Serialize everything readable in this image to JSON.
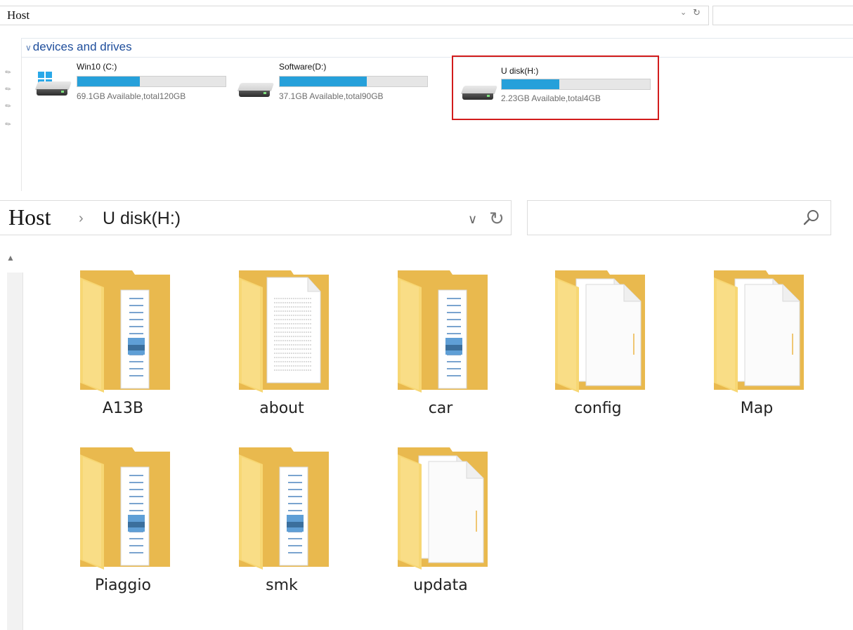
{
  "top_bar": {
    "location": "Host"
  },
  "devices_group": {
    "title": "devices and drives"
  },
  "drives": [
    {
      "name": "Win10 (C:)",
      "info": "69.1GB Available,total120GB",
      "used_fraction": 0.42,
      "icon": "windows-drive-icon",
      "selected": false
    },
    {
      "name": "Software(D:)",
      "info": "37.1GB Available,total90GB",
      "used_fraction": 0.59,
      "icon": "hard-drive-icon",
      "selected": false
    },
    {
      "name": "U disk(H:)",
      "info": "2.23GB Available,total4GB",
      "used_fraction": 0.39,
      "icon": "hard-drive-icon",
      "selected": true
    }
  ],
  "main_bar": {
    "root": "Host",
    "separator": "›",
    "location": "U disk(H:)"
  },
  "folders": [
    {
      "name": "A13B",
      "style": "document"
    },
    {
      "name": "about",
      "style": "text"
    },
    {
      "name": "car",
      "style": "document"
    },
    {
      "name": "config",
      "style": "blank"
    },
    {
      "name": "Map",
      "style": "blank"
    },
    {
      "name": "Piaggio",
      "style": "document"
    },
    {
      "name": "smk",
      "style": "document"
    },
    {
      "name": "updata",
      "style": "blank"
    }
  ],
  "colors": {
    "progress": "#26a0da",
    "selection": "#d21c1c",
    "folder": "#f5d67a",
    "group_header": "#1f4e9c"
  }
}
